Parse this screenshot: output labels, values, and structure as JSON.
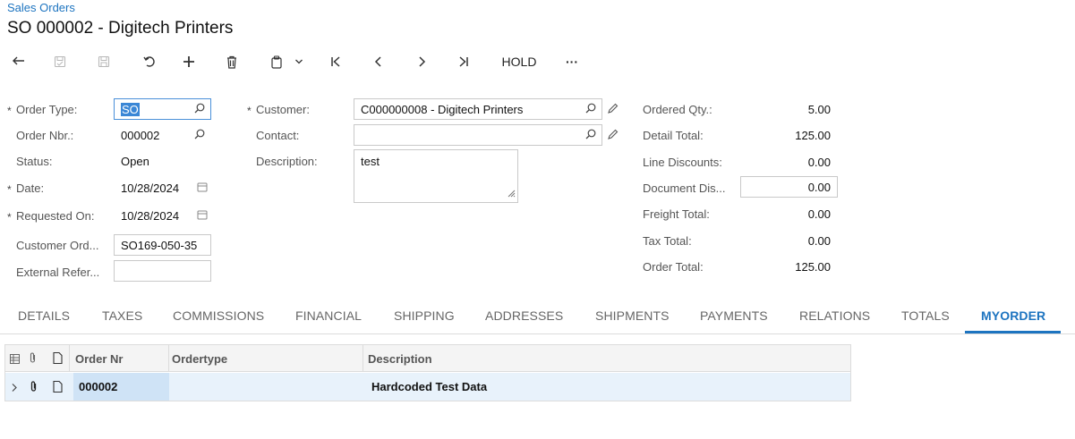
{
  "breadcrumb": "Sales Orders",
  "page_title": "SO 000002 - Digitech Printers",
  "toolbar": {
    "icons": [
      "back-arrow-icon",
      "save-close-icon",
      "save-icon",
      "undo-icon",
      "add-icon",
      "delete-icon",
      "copy-paste-icon",
      "first-record-icon",
      "previous-record-icon",
      "next-record-icon",
      "last-record-icon",
      "more-icon"
    ],
    "hold_label": "HOLD",
    "more_label": "···"
  },
  "form": {
    "order_type": {
      "label": "Order Type:",
      "value": "SO",
      "required": "*"
    },
    "order_nbr": {
      "label": "Order Nbr.:",
      "value": "000002"
    },
    "status": {
      "label": "Status:",
      "value": "Open"
    },
    "date": {
      "label": "Date:",
      "value": "10/28/2024",
      "required": "*"
    },
    "requested_on": {
      "label": "Requested On:",
      "value": "10/28/2024",
      "required": "*"
    },
    "customer_order": {
      "label": "Customer Ord...",
      "value": "SO169-050-35"
    },
    "external_ref": {
      "label": "External Refer...",
      "value": ""
    },
    "customer": {
      "label": "Customer:",
      "value": "C000000008 - Digitech Printers",
      "required": "*"
    },
    "contact": {
      "label": "Contact:",
      "value": ""
    },
    "description": {
      "label": "Description:",
      "value": "test"
    }
  },
  "totals": {
    "ordered_qty": {
      "label": "Ordered Qty.:",
      "value": "5.00"
    },
    "detail_total": {
      "label": "Detail Total:",
      "value": "125.00"
    },
    "line_discounts": {
      "label": "Line Discounts:",
      "value": "0.00"
    },
    "document_discount": {
      "label": "Document Dis...",
      "value": "0.00"
    },
    "freight_total": {
      "label": "Freight Total:",
      "value": "0.00"
    },
    "tax_total": {
      "label": "Tax Total:",
      "value": "0.00"
    },
    "order_total": {
      "label": "Order Total:",
      "value": "125.00"
    }
  },
  "tabs": [
    "DETAILS",
    "TAXES",
    "COMMISSIONS",
    "FINANCIAL",
    "SHIPPING",
    "ADDRESSES",
    "SHIPMENTS",
    "PAYMENTS",
    "RELATIONS",
    "TOTALS",
    "MYORDER"
  ],
  "active_tab": "MYORDER",
  "grid": {
    "columns": [
      "Order Nr",
      "Ordertype",
      "Description"
    ],
    "rows": [
      {
        "order_nr": "000002",
        "ordertype": "",
        "description": "Hardcoded Test Data"
      }
    ]
  },
  "colors": {
    "accent": "#1d74c0",
    "selected_row": "#e8f2fb"
  }
}
